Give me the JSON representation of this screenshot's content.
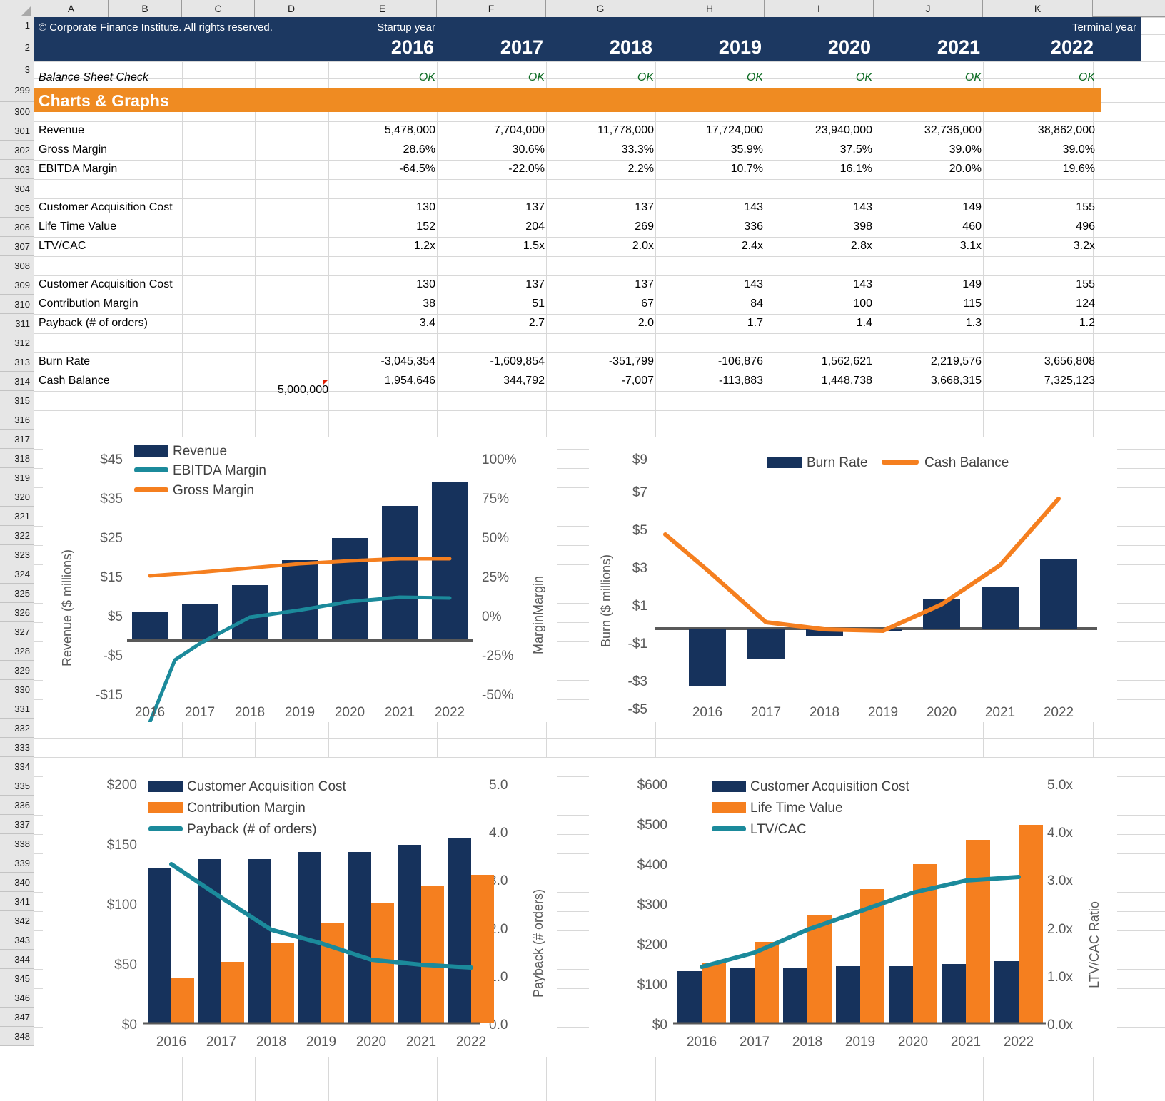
{
  "workbook": {
    "column_headers": [
      "A",
      "B",
      "C",
      "D",
      "E",
      "F",
      "G",
      "H",
      "I",
      "J",
      "K"
    ],
    "row_headers": [
      "1",
      "2",
      "3",
      "299",
      "300",
      "301",
      "302",
      "303",
      "304",
      "305",
      "306",
      "307",
      "308",
      "309",
      "310",
      "311",
      "312",
      "313",
      "314",
      "315",
      "316",
      "317",
      "318",
      "319",
      "320",
      "321",
      "322",
      "323",
      "324",
      "325",
      "326",
      "327",
      "328",
      "329",
      "330",
      "331",
      "332",
      "333",
      "334",
      "335",
      "336",
      "337",
      "338",
      "339",
      "340",
      "341",
      "342",
      "343",
      "344",
      "345",
      "346",
      "347",
      "348"
    ],
    "select_all_icon": "select-all-triangle"
  },
  "header": {
    "copyright": "© Corporate Finance Institute. All rights reserved.",
    "startup_year_label": "Startup year",
    "terminal_year_label": "Terminal year",
    "years": [
      "2016",
      "2017",
      "2018",
      "2019",
      "2020",
      "2021",
      "2022"
    ],
    "balance_sheet_check_label": "Balance Sheet Check",
    "balance_sheet_check_values": [
      "OK",
      "OK",
      "OK",
      "OK",
      "OK",
      "OK",
      "OK"
    ]
  },
  "section": {
    "title": "Charts & Graphs"
  },
  "table": {
    "rows": [
      {
        "row": "301",
        "label": "Revenue",
        "values": [
          "5,478,000",
          "7,704,000",
          "11,778,000",
          "17,724,000",
          "23,940,000",
          "32,736,000",
          "38,862,000"
        ]
      },
      {
        "row": "302",
        "label": "Gross Margin",
        "values": [
          "28.6%",
          "30.6%",
          "33.3%",
          "35.9%",
          "37.5%",
          "39.0%",
          "39.0%"
        ]
      },
      {
        "row": "303",
        "label": "EBITDA Margin",
        "values": [
          "-64.5%",
          "-22.0%",
          "2.2%",
          "10.7%",
          "16.1%",
          "20.0%",
          "19.6%"
        ]
      },
      {
        "row": "305",
        "label": "Customer Acquisition Cost",
        "values": [
          "130",
          "137",
          "137",
          "143",
          "143",
          "149",
          "155"
        ]
      },
      {
        "row": "306",
        "label": "Life Time Value",
        "values": [
          "152",
          "204",
          "269",
          "336",
          "398",
          "460",
          "496"
        ]
      },
      {
        "row": "307",
        "label": "LTV/CAC",
        "values": [
          "1.2x",
          "1.5x",
          "2.0x",
          "2.4x",
          "2.8x",
          "3.1x",
          "3.2x"
        ]
      },
      {
        "row": "309",
        "label": "Customer Acquisition Cost",
        "values": [
          "130",
          "137",
          "137",
          "143",
          "143",
          "149",
          "155"
        ]
      },
      {
        "row": "310",
        "label": "Contribution Margin",
        "values": [
          "38",
          "51",
          "67",
          "84",
          "100",
          "115",
          "124"
        ]
      },
      {
        "row": "311",
        "label": "Payback (# of orders)",
        "values": [
          "3.4",
          "2.7",
          "2.0",
          "1.7",
          "1.4",
          "1.3",
          "1.2"
        ]
      },
      {
        "row": "313",
        "label": "Burn Rate",
        "values": [
          "-3,045,354",
          "-1,609,854",
          "-351,799",
          "-106,876",
          "1,562,621",
          "2,219,576",
          "3,656,808"
        ]
      },
      {
        "row": "314",
        "label": "Cash Balance",
        "values": [
          "1,954,646",
          "344,792",
          "-7,007",
          "-113,883",
          "1,448,738",
          "3,668,315",
          "7,325,123"
        ]
      }
    ],
    "opening_cash": "5,000,000",
    "opening_cash_has_comment": true
  },
  "colors": {
    "navy": "#16325c",
    "orange": "#f57f1f",
    "teal": "#1b8a9b",
    "band_navy": "#1c3861",
    "band_orange": "#ef8b22",
    "axis_gray": "#595959",
    "zero_line": "#595959"
  },
  "chart_data": [
    {
      "id": "revenue-margins",
      "type": "bar",
      "title": "",
      "categories": [
        "2016",
        "2017",
        "2018",
        "2019",
        "2020",
        "2021",
        "2022"
      ],
      "xlabel": "",
      "ylabel": "Revenue ($ millions)",
      "y2label": "MarginMargin",
      "ylim": [
        -15,
        45
      ],
      "yticks": [
        "-$15",
        "-$5",
        "$5",
        "$15",
        "$25",
        "$35",
        "$45"
      ],
      "ytickvals": [
        -15,
        -5,
        5,
        15,
        25,
        35,
        45
      ],
      "y2lim": [
        -50,
        100
      ],
      "y2ticks": [
        "-50%",
        "-25%",
        "0%",
        "25%",
        "50%",
        "75%",
        "100%"
      ],
      "y2tickvals": [
        -50,
        -25,
        0,
        25,
        50,
        75,
        100
      ],
      "grid": false,
      "legend_position": "top-left",
      "series": [
        {
          "name": "Revenue",
          "kind": "bar",
          "axis": "left",
          "color": "#16325c",
          "values": [
            5.478,
            7.704,
            11.778,
            17.724,
            23.94,
            32.736,
            38.862
          ]
        },
        {
          "name": "EBITDA Margin",
          "kind": "line",
          "axis": "right",
          "color": "#1b8a9b",
          "values": [
            -64.5,
            -22.0,
            2.2,
            10.7,
            16.1,
            20.0,
            19.6
          ]
        },
        {
          "name": "Gross Margin",
          "kind": "line",
          "axis": "right",
          "color": "#f57f1f",
          "values": [
            28.6,
            30.6,
            33.3,
            35.9,
            37.5,
            39.0,
            39.0
          ]
        }
      ]
    },
    {
      "id": "burn-cash",
      "type": "bar",
      "title": "",
      "categories": [
        "2016",
        "2017",
        "2018",
        "2019",
        "2020",
        "2021",
        "2022"
      ],
      "xlabel": "",
      "ylabel": "Burn ($ millions)",
      "ylim": [
        -5,
        9
      ],
      "yticks": [
        "-$5",
        "-$3",
        "-$1",
        "$1",
        "$3",
        "$5",
        "$7",
        "$9"
      ],
      "ytickvals": [
        -5,
        -3,
        -1,
        1,
        3,
        5,
        7,
        9
      ],
      "grid": false,
      "legend_position": "top-center",
      "series": [
        {
          "name": "Burn Rate",
          "kind": "bar",
          "axis": "left",
          "color": "#16325c",
          "values": [
            -3.045354,
            -1.609854,
            -0.351799,
            -0.106876,
            1.562621,
            2.219576,
            3.656808
          ]
        },
        {
          "name": "Cash Balance",
          "kind": "line",
          "axis": "left",
          "color": "#f57f1f",
          "values": [
            4.954646,
            1.954646,
            0.344792,
            -0.007007,
            -0.113883,
            1.448738,
            3.668315,
            7.325123
          ]
        }
      ],
      "cash_balance_points": [
        5.0,
        1.954646,
        0.344792,
        -0.007007,
        -0.113883,
        1.448738,
        3.668315,
        7.325123
      ]
    },
    {
      "id": "cac-payback",
      "type": "bar",
      "categories": [
        "2016",
        "2017",
        "2018",
        "2019",
        "2020",
        "2021",
        "2022"
      ],
      "xlabel": "",
      "ylabel": "",
      "y2label": "Payback (# orders)",
      "ylim": [
        0,
        200
      ],
      "yticks": [
        "$0",
        "$50",
        "$100",
        "$150",
        "$200"
      ],
      "ytickvals": [
        0,
        50,
        100,
        150,
        200
      ],
      "y2lim": [
        0,
        5
      ],
      "y2ticks": [
        "0.0",
        "1.0",
        "2.0",
        "3.0",
        "4.0",
        "5.0"
      ],
      "y2tickvals": [
        0,
        1,
        2,
        3,
        4,
        5
      ],
      "grid": false,
      "legend_position": "top-left",
      "series": [
        {
          "name": "Customer Acquisition Cost",
          "kind": "bar",
          "axis": "left",
          "color": "#16325c",
          "values": [
            130,
            137,
            137,
            143,
            143,
            149,
            155
          ]
        },
        {
          "name": "Contribution Margin",
          "kind": "bar",
          "axis": "left",
          "color": "#f57f1f",
          "values": [
            38,
            51,
            67,
            84,
            100,
            115,
            124
          ]
        },
        {
          "name": "Payback (# of orders)",
          "kind": "line",
          "axis": "right",
          "color": "#1b8a9b",
          "values": [
            3.4,
            2.7,
            2.0,
            1.7,
            1.4,
            1.3,
            1.2
          ]
        }
      ]
    },
    {
      "id": "ltv-cac",
      "type": "bar",
      "categories": [
        "2016",
        "2017",
        "2018",
        "2019",
        "2020",
        "2021",
        "2022"
      ],
      "xlabel": "",
      "ylabel": "",
      "y2label": "LTV/CAC Ratio",
      "ylim": [
        0,
        600
      ],
      "yticks": [
        "$0",
        "$100",
        "$200",
        "$300",
        "$400",
        "$500",
        "$600"
      ],
      "ytickvals": [
        0,
        100,
        200,
        300,
        400,
        500,
        600
      ],
      "y2lim": [
        0,
        5
      ],
      "y2ticks": [
        "0.0x",
        "1.0x",
        "2.0x",
        "3.0x",
        "4.0x",
        "5.0x"
      ],
      "y2tickvals": [
        0,
        1,
        2,
        3,
        4,
        5
      ],
      "grid": false,
      "legend_position": "top-left",
      "series": [
        {
          "name": "Customer Acquisition Cost",
          "kind": "bar",
          "axis": "left",
          "color": "#16325c",
          "values": [
            130,
            137,
            137,
            143,
            143,
            149,
            155
          ]
        },
        {
          "name": "Life Time Value",
          "kind": "bar",
          "axis": "left",
          "color": "#f57f1f",
          "values": [
            152,
            204,
            269,
            336,
            398,
            460,
            496
          ]
        },
        {
          "name": "LTV/CAC",
          "kind": "line",
          "axis": "right",
          "color": "#1b8a9b",
          "values": [
            1.2,
            1.5,
            2.0,
            2.4,
            2.8,
            3.1,
            3.2
          ]
        }
      ]
    }
  ]
}
